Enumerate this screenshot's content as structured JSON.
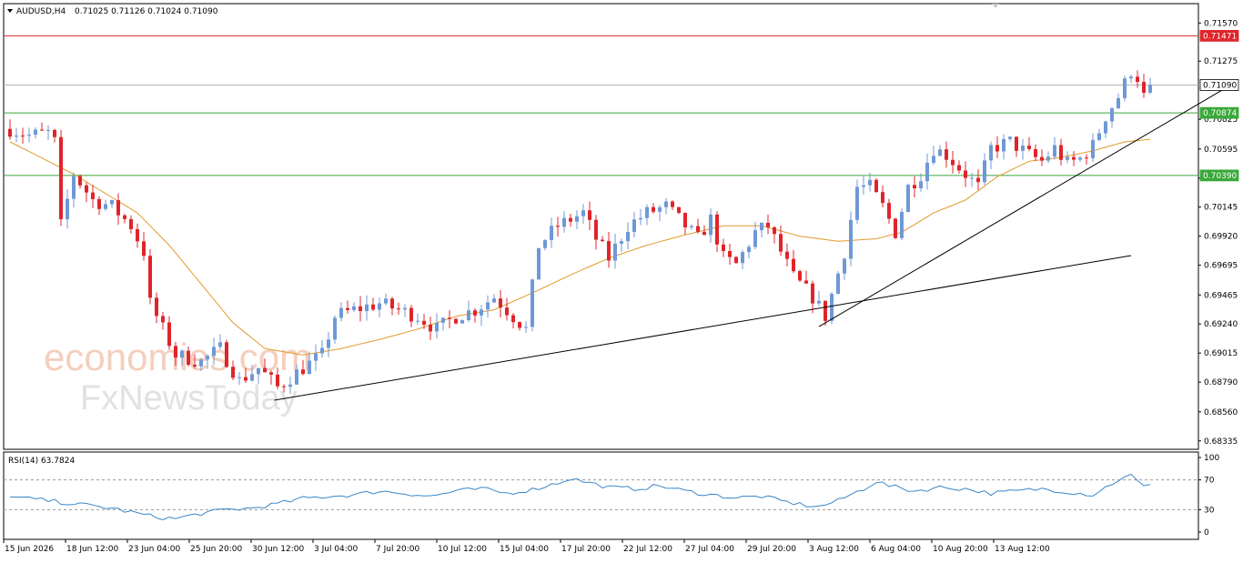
{
  "header": {
    "symbol_label": "AUDUSD,H4",
    "ohlc": "0.71025 0.71126 0.71024 0.71090"
  },
  "rsi_header": {
    "label": "RSI(14) 63.7824"
  },
  "watermark": {
    "line1": "economies.com",
    "line2": "FxNewsToday"
  },
  "colors": {
    "bull": "#6f98d6",
    "bear": "#e0242b",
    "ma": "#e19a2a",
    "red_line": "#e0242b",
    "green_line": "#3aa83a",
    "price_line": "#b4b4b4",
    "rsi": "#3a86c8",
    "trend": "#000000"
  },
  "chart_data": [
    {
      "type": "candlestick",
      "title": "AUDUSD,H4",
      "ylim": [
        0.6827,
        0.7172
      ],
      "price_axis_ticks": [
        "0.71570",
        "0.71275",
        "0.70825",
        "0.70595",
        "0.70370",
        "0.70145",
        "0.69920",
        "0.69695",
        "0.69465",
        "0.69240",
        "0.69015",
        "0.68790",
        "0.68560",
        "0.68335"
      ],
      "time_labels": [
        "15 Jun 2026",
        "18 Jun 12:00",
        "23 Jun 04:00",
        "25 Jun 20:00",
        "30 Jun 12:00",
        "3 Jul 04:00",
        "7 Jul 20:00",
        "10 Jul 12:00",
        "15 Jul 04:00",
        "17 Jul 20:00",
        "22 Jul 12:00",
        "27 Jul 04:00",
        "29 Jul 20:00",
        "3 Aug 12:00",
        "6 Aug 04:00",
        "10 Aug 20:00",
        "13 Aug 12:00"
      ],
      "bar_count": 180,
      "horizontal_levels": [
        {
          "price": 0.71471,
          "label": "0.71471",
          "color": "#e0242b"
        },
        {
          "price": 0.7109,
          "label": "0.71090",
          "color": "#b4b4b4"
        },
        {
          "price": 0.70874,
          "label": "0.70874",
          "color": "#3aa83a"
        },
        {
          "price": 0.7039,
          "label": "0.70390",
          "color": "#3aa83a"
        }
      ],
      "trendlines": [
        {
          "from": [
            41.5,
            0.6865
          ],
          "to": [
            176,
            0.6977
          ]
        },
        {
          "from": [
            127,
            0.6922
          ],
          "to": [
            192,
            0.711
          ]
        }
      ],
      "price_path": [
        [
          0,
          0.7075
        ],
        [
          3,
          0.707
        ],
        [
          6,
          0.7072
        ],
        [
          7,
          0.7065
        ],
        [
          8,
          0.7
        ],
        [
          10,
          0.704
        ],
        [
          13,
          0.702
        ],
        [
          16,
          0.7015
        ],
        [
          19,
          0.7
        ],
        [
          21,
          0.698
        ],
        [
          22,
          0.694
        ],
        [
          24,
          0.692
        ],
        [
          26,
          0.69
        ],
        [
          30,
          0.6895
        ],
        [
          33,
          0.6905
        ],
        [
          36,
          0.688
        ],
        [
          39,
          0.689
        ],
        [
          42,
          0.6875
        ],
        [
          46,
          0.689
        ],
        [
          49,
          0.69
        ],
        [
          51,
          0.693
        ],
        [
          54,
          0.6935
        ],
        [
          58,
          0.694
        ],
        [
          61,
          0.6935
        ],
        [
          64,
          0.693
        ],
        [
          67,
          0.692
        ],
        [
          70,
          0.693
        ],
        [
          73,
          0.6935
        ],
        [
          76,
          0.6945
        ],
        [
          79,
          0.693
        ],
        [
          81,
          0.692
        ],
        [
          83,
          0.6985
        ],
        [
          86,
          0.7
        ],
        [
          88,
          0.7005
        ],
        [
          90,
          0.701
        ],
        [
          92,
          0.699
        ],
        [
          94,
          0.6975
        ],
        [
          97,
          0.7
        ],
        [
          100,
          0.701
        ],
        [
          103,
          0.7015
        ],
        [
          106,
          0.7
        ],
        [
          108,
          0.699
        ],
        [
          110,
          0.7005
        ],
        [
          112,
          0.6975
        ],
        [
          114,
          0.697
        ],
        [
          117,
          0.6995
        ],
        [
          119,
          0.7
        ],
        [
          121,
          0.698
        ],
        [
          123,
          0.696
        ],
        [
          126,
          0.6945
        ],
        [
          128,
          0.693
        ],
        [
          131,
          0.698
        ],
        [
          133,
          0.703
        ],
        [
          135,
          0.703
        ],
        [
          137,
          0.7015
        ],
        [
          139,
          0.6995
        ],
        [
          141,
          0.703
        ],
        [
          143,
          0.704
        ],
        [
          145,
          0.706
        ],
        [
          147,
          0.7055
        ],
        [
          150,
          0.704
        ],
        [
          152,
          0.703
        ],
        [
          154,
          0.706
        ],
        [
          157,
          0.7065
        ],
        [
          160,
          0.7055
        ],
        [
          162,
          0.705
        ],
        [
          164,
          0.706
        ],
        [
          166,
          0.7048
        ],
        [
          168,
          0.7052
        ],
        [
          170,
          0.7062
        ],
        [
          172,
          0.7085
        ],
        [
          174,
          0.71
        ],
        [
          176,
          0.712
        ],
        [
          177,
          0.7115
        ],
        [
          178,
          0.71
        ],
        [
          179,
          0.7109
        ]
      ],
      "ma_path": [
        [
          0,
          0.7065
        ],
        [
          10,
          0.704
        ],
        [
          20,
          0.701
        ],
        [
          25,
          0.6985
        ],
        [
          30,
          0.6955
        ],
        [
          35,
          0.6925
        ],
        [
          40,
          0.6905
        ],
        [
          46,
          0.69
        ],
        [
          52,
          0.6905
        ],
        [
          58,
          0.6912
        ],
        [
          64,
          0.692
        ],
        [
          70,
          0.693
        ],
        [
          76,
          0.6935
        ],
        [
          82,
          0.6948
        ],
        [
          88,
          0.6962
        ],
        [
          94,
          0.6975
        ],
        [
          100,
          0.6985
        ],
        [
          106,
          0.6993
        ],
        [
          112,
          0.7
        ],
        [
          118,
          0.7
        ],
        [
          124,
          0.6992
        ],
        [
          130,
          0.6988
        ],
        [
          136,
          0.699
        ],
        [
          140,
          0.6995
        ],
        [
          145,
          0.701
        ],
        [
          150,
          0.702
        ],
        [
          155,
          0.7038
        ],
        [
          160,
          0.705
        ],
        [
          165,
          0.7053
        ],
        [
          170,
          0.7058
        ],
        [
          175,
          0.7065
        ],
        [
          179,
          0.7067
        ]
      ]
    },
    {
      "type": "line",
      "title": "RSI(14) 63.7824",
      "ylim": [
        0,
        100
      ],
      "ticks": [
        100,
        70,
        30,
        0
      ],
      "levels": [
        70,
        30
      ],
      "rsi_path": [
        [
          0,
          47
        ],
        [
          4,
          44
        ],
        [
          8,
          40
        ],
        [
          12,
          36
        ],
        [
          16,
          32
        ],
        [
          20,
          25
        ],
        [
          23,
          20
        ],
        [
          26,
          18
        ],
        [
          30,
          25
        ],
        [
          34,
          30
        ],
        [
          38,
          32
        ],
        [
          42,
          38
        ],
        [
          46,
          45
        ],
        [
          50,
          48
        ],
        [
          54,
          50
        ],
        [
          58,
          55
        ],
        [
          62,
          52
        ],
        [
          66,
          48
        ],
        [
          70,
          55
        ],
        [
          74,
          58
        ],
        [
          78,
          52
        ],
        [
          82,
          57
        ],
        [
          86,
          66
        ],
        [
          88,
          72
        ],
        [
          90,
          68
        ],
        [
          94,
          60
        ],
        [
          98,
          58
        ],
        [
          102,
          62
        ],
        [
          106,
          55
        ],
        [
          110,
          50
        ],
        [
          114,
          46
        ],
        [
          118,
          48
        ],
        [
          122,
          40
        ],
        [
          125,
          36
        ],
        [
          127,
          34
        ],
        [
          130,
          42
        ],
        [
          134,
          58
        ],
        [
          136,
          68
        ],
        [
          138,
          62
        ],
        [
          142,
          55
        ],
        [
          146,
          60
        ],
        [
          150,
          58
        ],
        [
          154,
          52
        ],
        [
          158,
          55
        ],
        [
          162,
          58
        ],
        [
          166,
          54
        ],
        [
          170,
          50
        ],
        [
          174,
          70
        ],
        [
          176,
          76
        ],
        [
          178,
          60
        ],
        [
          179,
          63.78
        ]
      ],
      "last_value": 63.7824
    }
  ]
}
